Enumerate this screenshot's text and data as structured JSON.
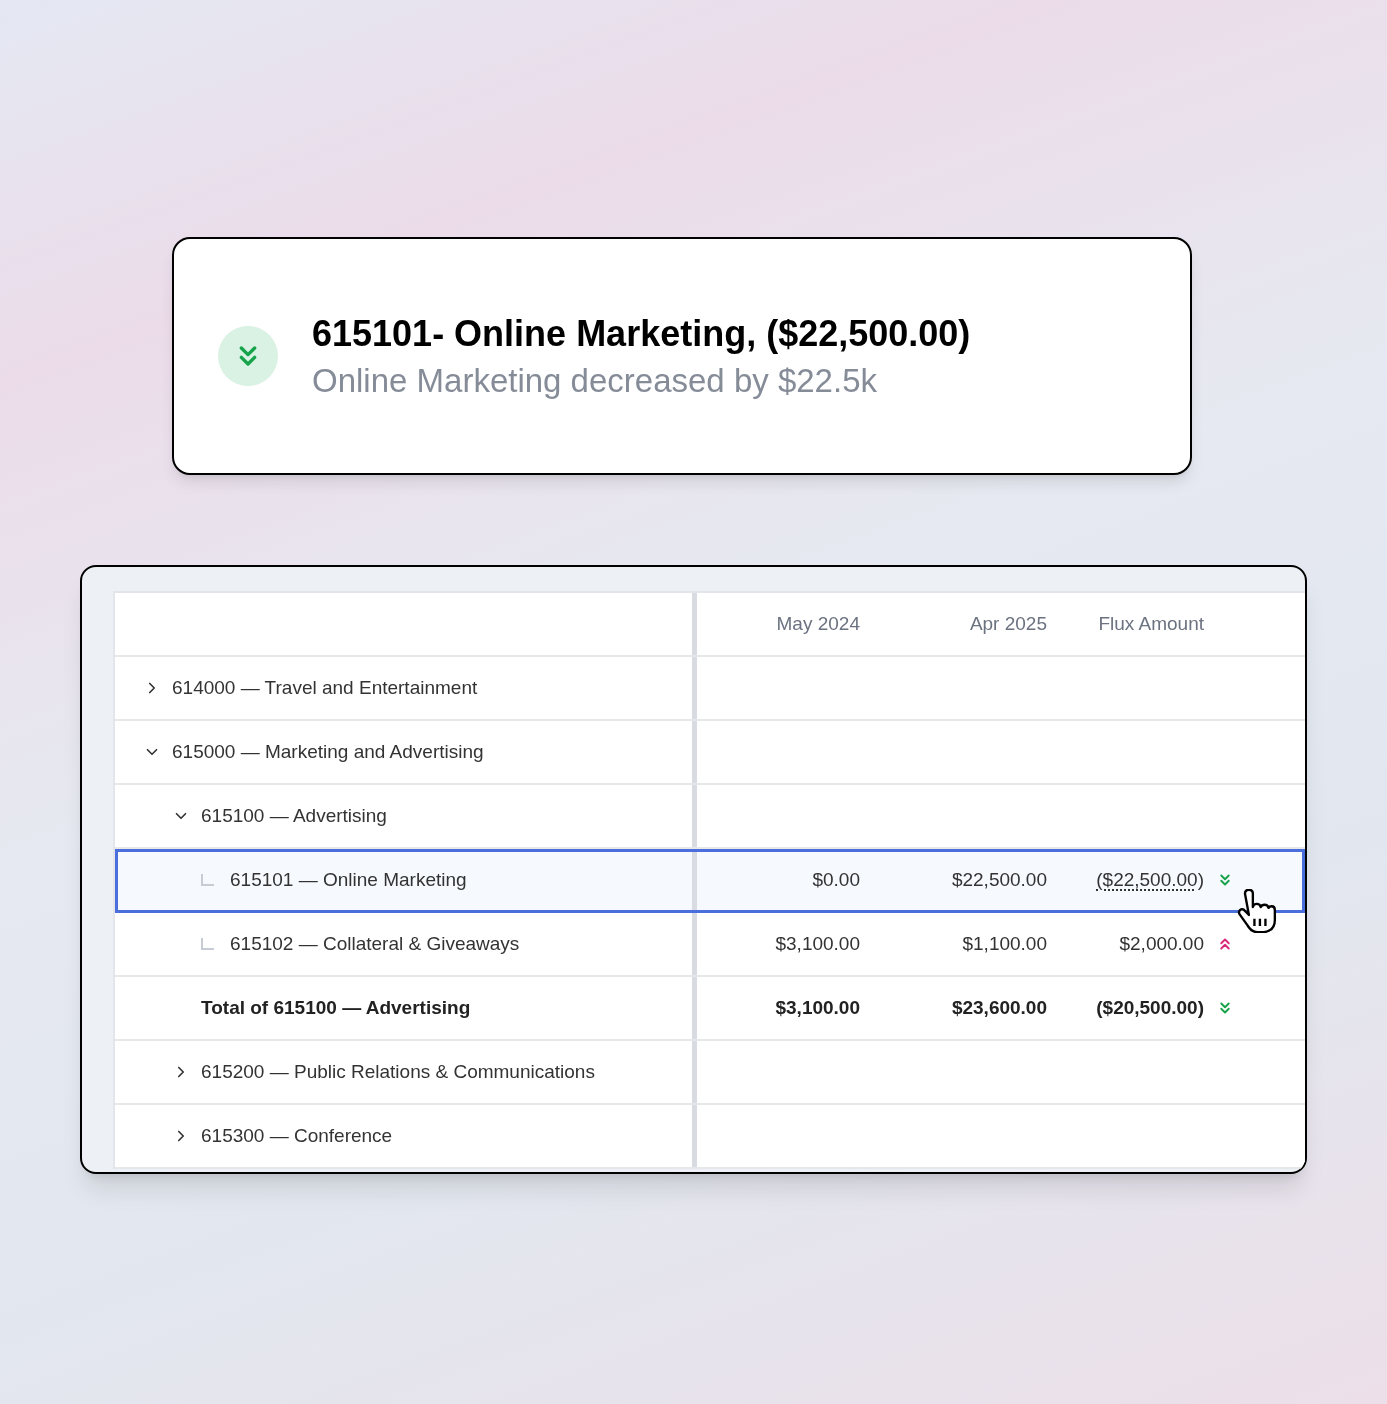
{
  "alert": {
    "increase": false,
    "title": "615101- Online Marketing, ($22,500.00)",
    "subtitle": "Online Marketing decreased by $22.5k"
  },
  "table": {
    "columns": [
      "May 2024",
      "Apr 2025",
      "Flux Amount"
    ],
    "rows": [
      {
        "kind": "group",
        "label": "614000 — Travel and Entertainment",
        "expanded": false
      },
      {
        "kind": "group",
        "label": "615000 — Marketing and Advertising",
        "expanded": true,
        "children": [
          {
            "kind": "group",
            "label": "615100 — Advertising",
            "expanded": true,
            "children": [
              {
                "kind": "leaf",
                "label": "615101 — Online Marketing",
                "selected": true,
                "values": [
                  "$0.00",
                  "$22,500.00",
                  "($22,500.00)"
                ],
                "increase": false
              },
              {
                "kind": "leaf",
                "label": "615102 — Collateral & Giveaways",
                "selected": false,
                "values": [
                  "$3,100.00",
                  "$1,100.00",
                  "$2,000.00"
                ],
                "increase": true
              },
              {
                "kind": "total",
                "label": "Total of 615100 — Advertising",
                "values": [
                  "$3,100.00",
                  "$23,600.00",
                  "($20,500.00)"
                ],
                "increase": false
              }
            ]
          },
          {
            "kind": "group",
            "label": "615200 — Public Relations & Communications",
            "expanded": false
          },
          {
            "kind": "group",
            "label": "615300 — Conference",
            "expanded": false
          }
        ]
      }
    ]
  }
}
